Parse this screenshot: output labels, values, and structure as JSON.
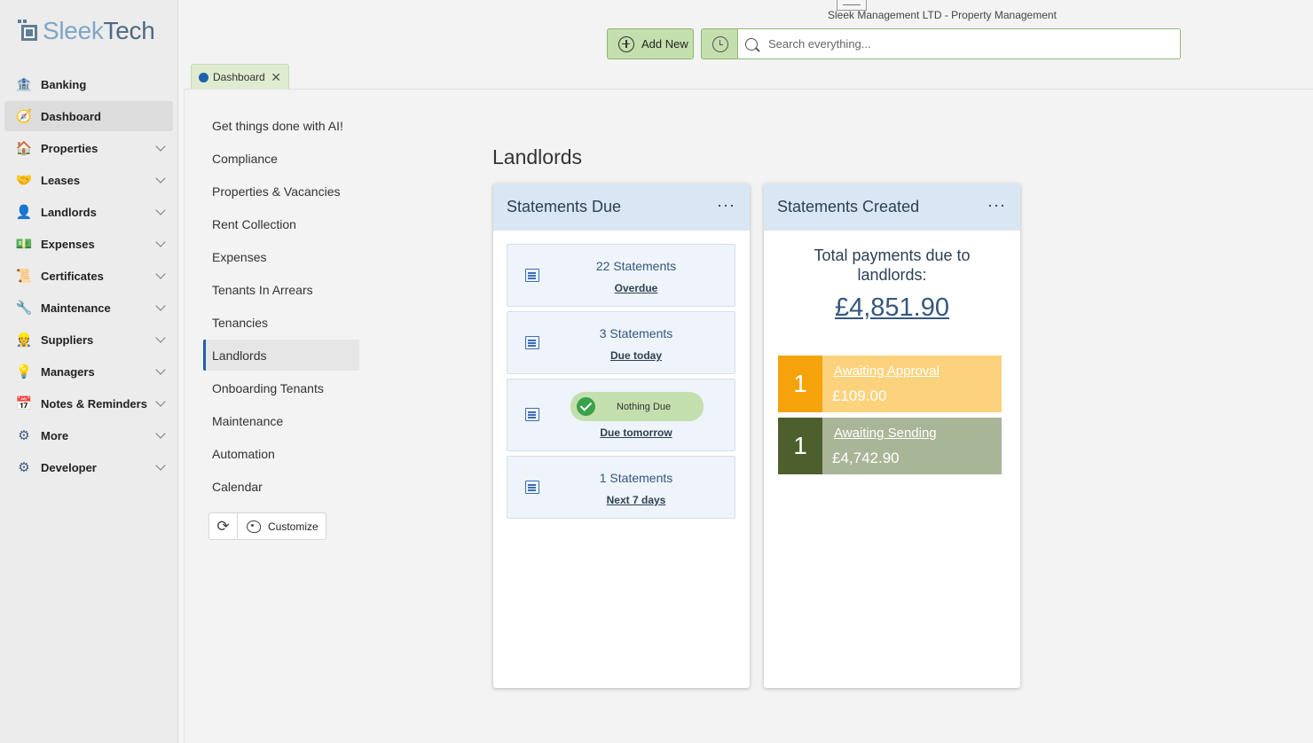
{
  "app": {
    "logo_part1": "Sleek",
    "logo_part2": "Tech",
    "header_title": "Sleek Management LTD - Property Management"
  },
  "toolbar": {
    "add_new_label": "Add New",
    "search_placeholder": "Search everything..."
  },
  "tab": {
    "label": "Dashboard",
    "close": "✕"
  },
  "sidebar": {
    "items": [
      {
        "label": "Banking",
        "icon": "bank-icon",
        "glyph": "🏦"
      },
      {
        "label": "Dashboard",
        "icon": "dashboard-icon",
        "glyph": "🧭"
      },
      {
        "label": "Properties",
        "icon": "house-icon",
        "glyph": "🏠"
      },
      {
        "label": "Leases",
        "icon": "handshake-icon",
        "glyph": "🤝"
      },
      {
        "label": "Landlords",
        "icon": "person-icon",
        "glyph": "👤"
      },
      {
        "label": "Expenses",
        "icon": "money-icon",
        "glyph": "💵"
      },
      {
        "label": "Certificates",
        "icon": "certificate-icon",
        "glyph": "📜"
      },
      {
        "label": "Maintenance",
        "icon": "wrench-icon",
        "glyph": "🔧"
      },
      {
        "label": "Suppliers",
        "icon": "worker-icon",
        "glyph": "👷"
      },
      {
        "label": "Managers",
        "icon": "manager-icon",
        "glyph": "💡"
      },
      {
        "label": "Notes & Reminders",
        "icon": "calendar-icon",
        "glyph": "📅"
      },
      {
        "label": "More",
        "icon": "gear-icon",
        "glyph": "⚙"
      },
      {
        "label": "Developer",
        "icon": "cog-icon",
        "glyph": "⚙"
      }
    ]
  },
  "subnav": {
    "items": [
      "Get things done with AI!",
      "Compliance",
      "Properties & Vacancies",
      "Rent Collection",
      "Expenses",
      "Tenants In Arrears",
      "Tenancies",
      "Landlords",
      "Onboarding Tenants",
      "Maintenance",
      "Automation",
      "Calendar"
    ],
    "customize_label": "Customize"
  },
  "section": {
    "title": "Landlords"
  },
  "statements_due": {
    "title": "Statements Due",
    "menu": "···",
    "rows": [
      {
        "count": "22 Statements",
        "link": "Overdue"
      },
      {
        "count": "3 Statements",
        "link": "Due today"
      },
      {
        "pill": "Nothing Due",
        "link": "Due tomorrow"
      },
      {
        "count": "1 Statements",
        "link": "Next 7 days"
      }
    ]
  },
  "statements_created": {
    "title": "Statements Created",
    "menu": "···",
    "total_label": "Total payments due to landlords:",
    "total_value": "£4,851.90",
    "statuses": [
      {
        "count": "1",
        "label": "Awaiting Approval",
        "amount": "£109.00",
        "color_num": "#f5a20b",
        "color_body": "#fdd27c"
      },
      {
        "count": "1",
        "label": "Awaiting Sending",
        "amount": "£4,742.90",
        "color_num": "#4e5f2e",
        "color_body": "#a9b597"
      }
    ]
  }
}
